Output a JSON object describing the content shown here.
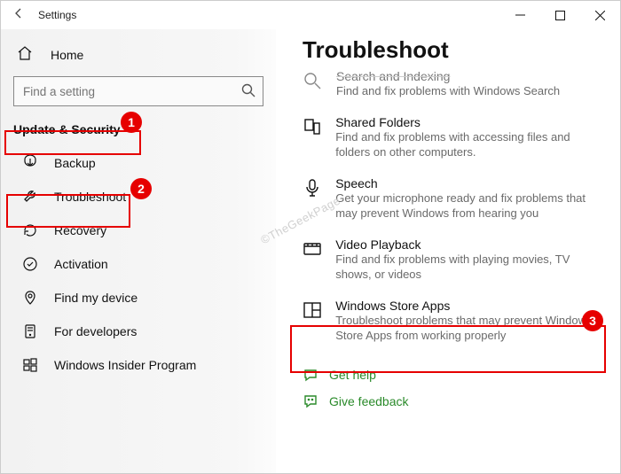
{
  "window": {
    "title": "Settings"
  },
  "sidebar": {
    "home": "Home",
    "search_placeholder": "Find a setting",
    "section": "Update & Security",
    "items": [
      {
        "label": "Backup"
      },
      {
        "label": "Troubleshoot"
      },
      {
        "label": "Recovery"
      },
      {
        "label": "Activation"
      },
      {
        "label": "Find my device"
      },
      {
        "label": "For developers"
      },
      {
        "label": "Windows Insider Program"
      }
    ]
  },
  "page": {
    "title": "Troubleshoot"
  },
  "troubleshoot": [
    {
      "title": "Search and Indexing",
      "desc": "Find and fix problems with Windows Search"
    },
    {
      "title": "Shared Folders",
      "desc": "Find and fix problems with accessing files and folders on other computers."
    },
    {
      "title": "Speech",
      "desc": "Get your microphone ready and fix problems that may prevent Windows from hearing you"
    },
    {
      "title": "Video Playback",
      "desc": "Find and fix problems with playing movies, TV shows, or videos"
    },
    {
      "title": "Windows Store Apps",
      "desc": "Troubleshoot problems that may prevent Windows Store Apps from working properly"
    }
  ],
  "footer": {
    "help": "Get help",
    "feedback": "Give feedback"
  },
  "callouts": {
    "n1": "1",
    "n2": "2",
    "n3": "3"
  },
  "watermark": "©TheGeekPage"
}
